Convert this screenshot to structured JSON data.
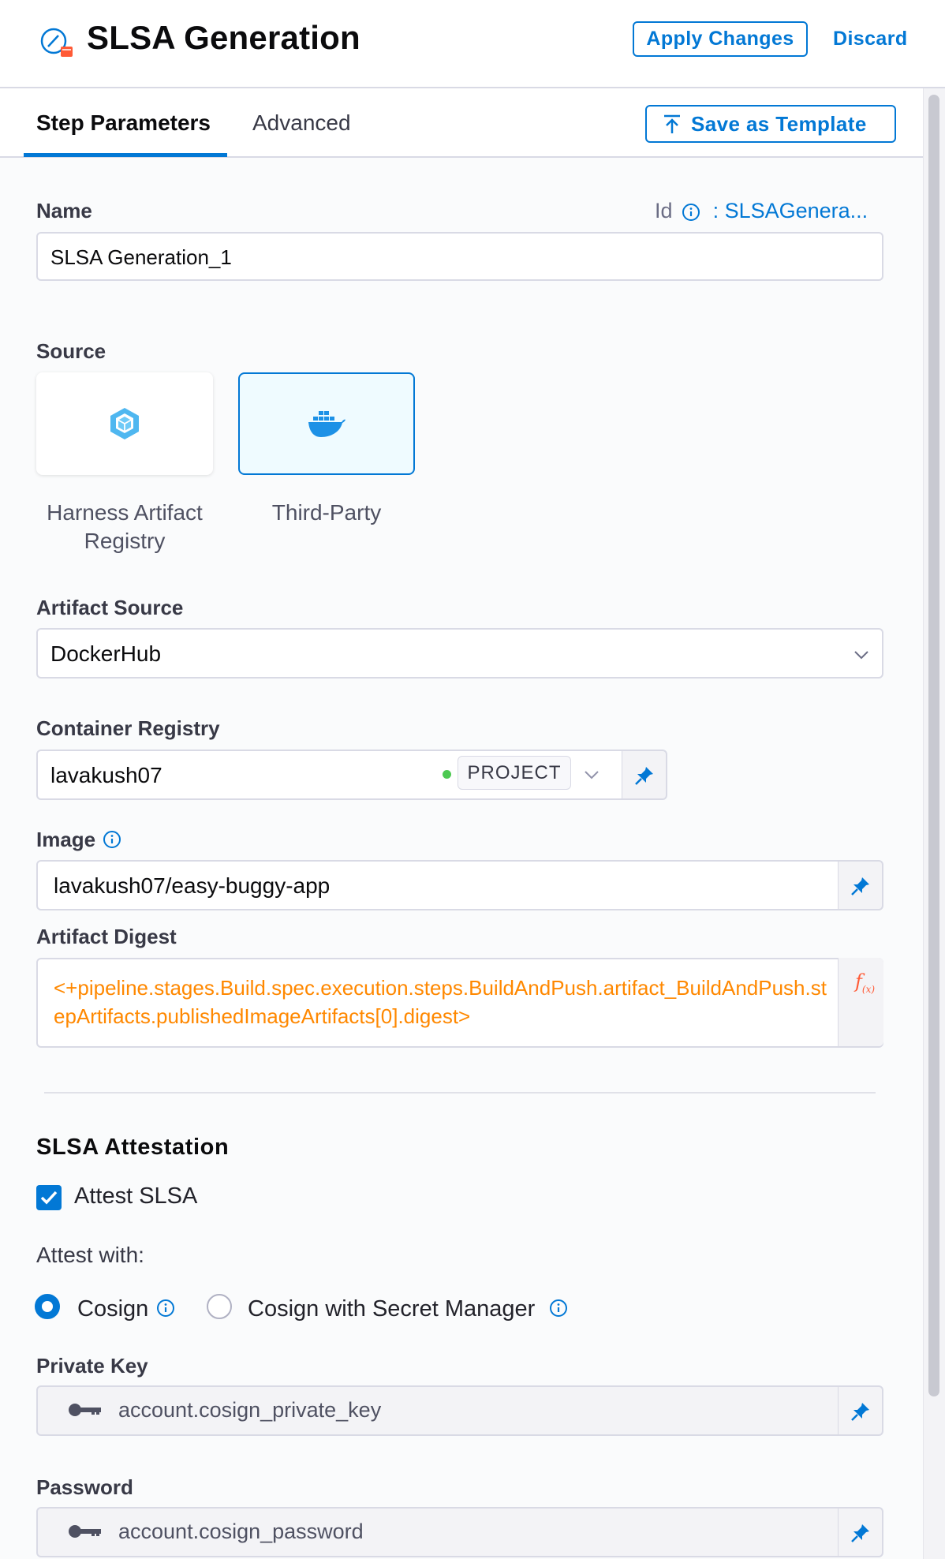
{
  "header": {
    "title": "SLSA Generation",
    "apply_label": "Apply Changes",
    "discard_label": "Discard"
  },
  "tabs": {
    "step_parameters": "Step Parameters",
    "advanced": "Advanced",
    "save_template": "Save as Template"
  },
  "name_field": {
    "label": "Name",
    "value": "SLSA Generation_1",
    "id_label": "Id",
    "id_value": ": SLSAGenera..."
  },
  "source": {
    "label": "Source",
    "options": [
      "Harness Artifact Registry",
      "Third-Party"
    ],
    "selected": "Third-Party"
  },
  "artifact_source": {
    "label": "Artifact Source",
    "value": "DockerHub"
  },
  "container_registry": {
    "label": "Container Registry",
    "value": "lavakush07",
    "scope": "PROJECT"
  },
  "image": {
    "label": "Image",
    "value": "lavakush07/easy-buggy-app"
  },
  "artifact_digest": {
    "label": "Artifact Digest",
    "value": "<+pipeline.stages.Build.spec.execution.steps.BuildAndPush.artifact_BuildAndPush.stepArtifacts.publishedImageArtifacts[0].digest>"
  },
  "attestation": {
    "title": "SLSA Attestation",
    "attest_label": "Attest SLSA",
    "attest_checked": true,
    "attest_with_label": "Attest with:",
    "options": [
      "Cosign",
      "Cosign with Secret Manager"
    ],
    "selected": "Cosign"
  },
  "private_key": {
    "label": "Private Key",
    "value": "account.cosign_private_key"
  },
  "password": {
    "label": "Password",
    "value": "account.cosign_password"
  },
  "colors": {
    "accent": "#0278d5",
    "expression": "#ff8800",
    "scope_dot": "#4dc952"
  }
}
